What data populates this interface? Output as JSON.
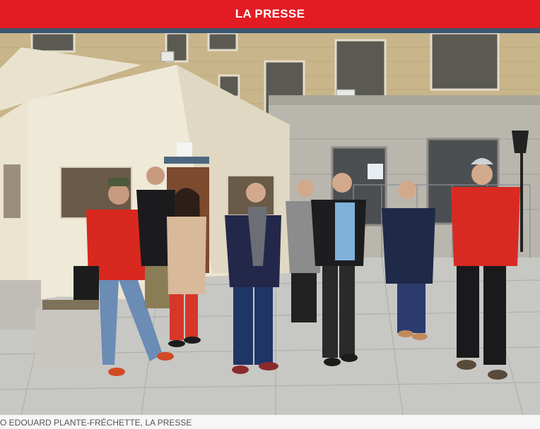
{
  "header": {
    "brand": "LA PRESSE",
    "background_color": "#e31b23",
    "accent_line_color": "#3d5670"
  },
  "photo": {
    "credit": "O EDOUARD PLANTE-FRÉCHETTE, LA PRESSE"
  }
}
